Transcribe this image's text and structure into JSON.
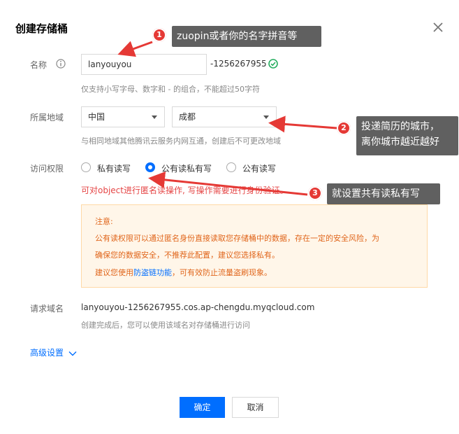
{
  "dialog": {
    "title": "创建存储桶",
    "close_icon": "close-icon"
  },
  "form": {
    "name": {
      "label": "名称",
      "info_icon": "info-icon",
      "value": "lanyouyou",
      "suffix": "-1256267955",
      "status_icon": "check-circle-icon",
      "hint": "仅支持小写字母、数字和 - 的组合，不能超过50字符"
    },
    "region": {
      "label": "所属地域",
      "country": "中国",
      "city": "成都",
      "hint": "与相同地域其他腾讯云服务内网互通，创建后不可更改地域"
    },
    "access": {
      "label": "访问权限",
      "options": [
        "私有读写",
        "公有读私有写",
        "公有读写"
      ],
      "selected": "公有读私有写",
      "warning": "可对object进行匿名读操作, 写操作需要进行身份验证。"
    },
    "notice": {
      "title": "注意:",
      "line1": "公有读权限可以通过匿名身份直接读取您存储桶中的数据，存在一定的安全风险，为",
      "line2": "确保您的数据安全，不推荐此配置，建议您选择私有。",
      "line3_prefix": "建议您使用",
      "line3_link": "防盗链功能",
      "line3_suffix": "，可有效防止流量盗刷现象。"
    },
    "domain": {
      "label": "请求域名",
      "value": "lanyouyou-1256267955.cos.ap-chengdu.myqcloud.com",
      "hint": "创建完成后，您可以使用该域名对存储桶进行访问"
    },
    "advanced": {
      "label": "高级设置"
    }
  },
  "buttons": {
    "confirm": "确定",
    "cancel": "取消"
  },
  "annotations": [
    {
      "number": "1",
      "text": "zuopin或者你的名字拼音等"
    },
    {
      "number": "2",
      "line1": "投递简历的城市，",
      "line2": "离你城市越近越好"
    },
    {
      "number": "3",
      "text": "就设置共有读私有写"
    }
  ],
  "colors": {
    "accent": "#006eff",
    "warning_red": "#e54545",
    "notice_bg": "#fff6e9",
    "notice_text": "#e0661c",
    "callout_bg": "#606060",
    "badge_red": "#e53935",
    "arrow_red": "#e53935",
    "ok_green": "#27ae60"
  }
}
